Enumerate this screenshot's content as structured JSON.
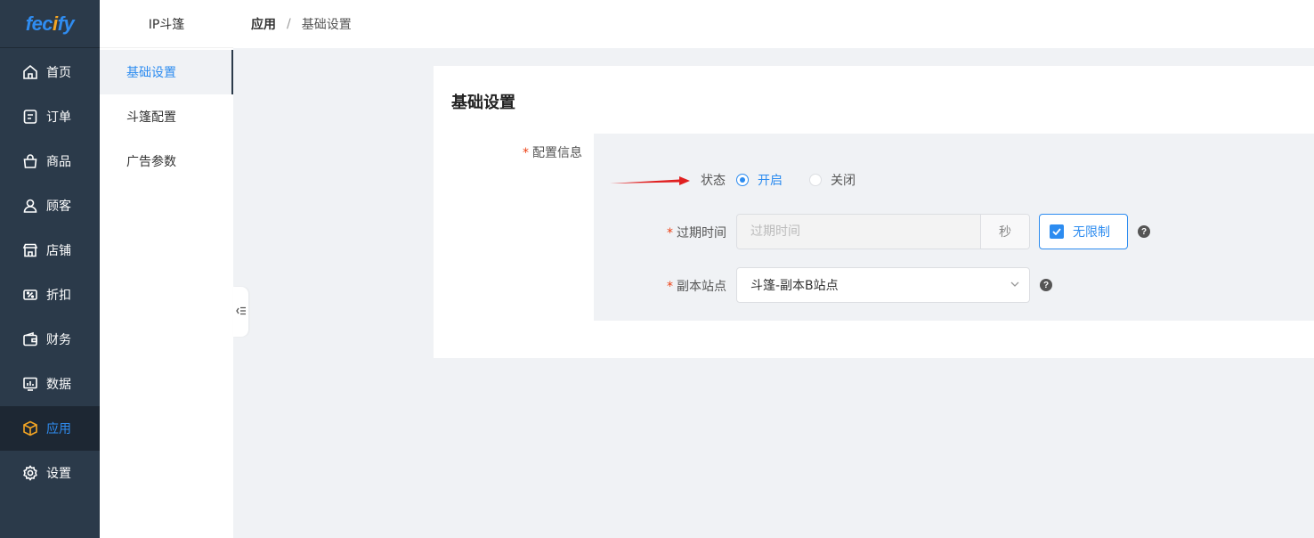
{
  "logo": {
    "pre": "fec",
    "o": "i",
    "post": "fy"
  },
  "nav": [
    {
      "label": "首页",
      "icon": "home-icon"
    },
    {
      "label": "订单",
      "icon": "order-icon"
    },
    {
      "label": "商品",
      "icon": "bag-icon"
    },
    {
      "label": "顾客",
      "icon": "user-icon"
    },
    {
      "label": "店铺",
      "icon": "store-icon"
    },
    {
      "label": "折扣",
      "icon": "discount-icon"
    },
    {
      "label": "财务",
      "icon": "wallet-icon"
    },
    {
      "label": "数据",
      "icon": "chart-icon"
    },
    {
      "label": "应用",
      "icon": "cube-icon",
      "active": true
    },
    {
      "label": "设置",
      "icon": "gear-icon"
    }
  ],
  "subnav": {
    "title": "IP斗篷",
    "items": [
      {
        "label": "基础设置",
        "active": true
      },
      {
        "label": "斗篷配置"
      },
      {
        "label": "广告参数"
      }
    ]
  },
  "breadcrumb": {
    "root": "应用",
    "sep": "/",
    "current": "基础设置"
  },
  "card": {
    "title": "基础设置",
    "config_label": "配置信息",
    "required_mark": "*",
    "status": {
      "label": "状态",
      "options": [
        "开启",
        "关闭"
      ],
      "selected": "开启"
    },
    "expire": {
      "label": "过期时间",
      "placeholder": "过期时间",
      "unit": "秒",
      "unlimited_label": "无限制",
      "unlimited_checked": true
    },
    "replica": {
      "label": "副本站点",
      "value": "斗篷-副本B站点"
    },
    "help_glyph": "?"
  },
  "colors": {
    "primary": "#2d8cf0",
    "nav_bg": "#2b3a4a",
    "required": "#ed4014",
    "annotation_arrow": "#e02020"
  }
}
